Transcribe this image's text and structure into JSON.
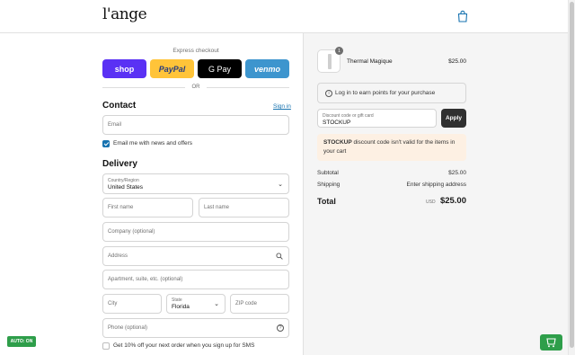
{
  "brand": {
    "logo_text": "l'ange"
  },
  "express": {
    "title": "Express checkout",
    "buttons": [
      "shop",
      "PayPal",
      "G Pay",
      "venmo"
    ],
    "or_text": "OR"
  },
  "contact": {
    "title": "Contact",
    "sign_in": "Sign in",
    "email_placeholder": "Email",
    "newsletter_label": "Email me with news and offers",
    "newsletter_checked": true
  },
  "delivery": {
    "title": "Delivery",
    "country_label": "Country/Region",
    "country_value": "United States",
    "first_name_placeholder": "First name",
    "last_name_placeholder": "Last name",
    "company_placeholder": "Company (optional)",
    "address_placeholder": "Address",
    "apartment_placeholder": "Apartment, suite, etc. (optional)",
    "city_placeholder": "City",
    "state_label": "State",
    "state_value": "Florida",
    "zip_placeholder": "ZIP code",
    "phone_placeholder": "Phone (optional)",
    "sms_label": "Get 10% off your next order when you sign up for SMS",
    "sms_checked": false
  },
  "order": {
    "items": [
      {
        "quantity": "1",
        "name": "Thermal Magique",
        "price": "$25.00"
      }
    ],
    "points_text": "Log in to earn points for your purchase",
    "discount_label": "Discount code or gift card",
    "discount_value": "STOCKUP",
    "apply_label": "Apply",
    "warning_code": "STOCKUP",
    "warning_text": " discount code isn't valid for the items in your cart",
    "subtotal_label": "Subtotal",
    "subtotal_value": "$25.00",
    "shipping_label": "Shipping",
    "shipping_value": "Enter shipping address",
    "total_label": "Total",
    "total_currency": "USD",
    "total_value": "$25.00"
  },
  "auto_badge": "AUTO: ON",
  "colors": {
    "shop": "#5a31f4",
    "paypal": "#ffc439",
    "gpay": "#000000",
    "venmo": "#3d95ce",
    "link": "#1773b0",
    "apply": "#303030",
    "warning_bg": "#fdf0e3",
    "auto_badge": "#2e9e4a"
  }
}
